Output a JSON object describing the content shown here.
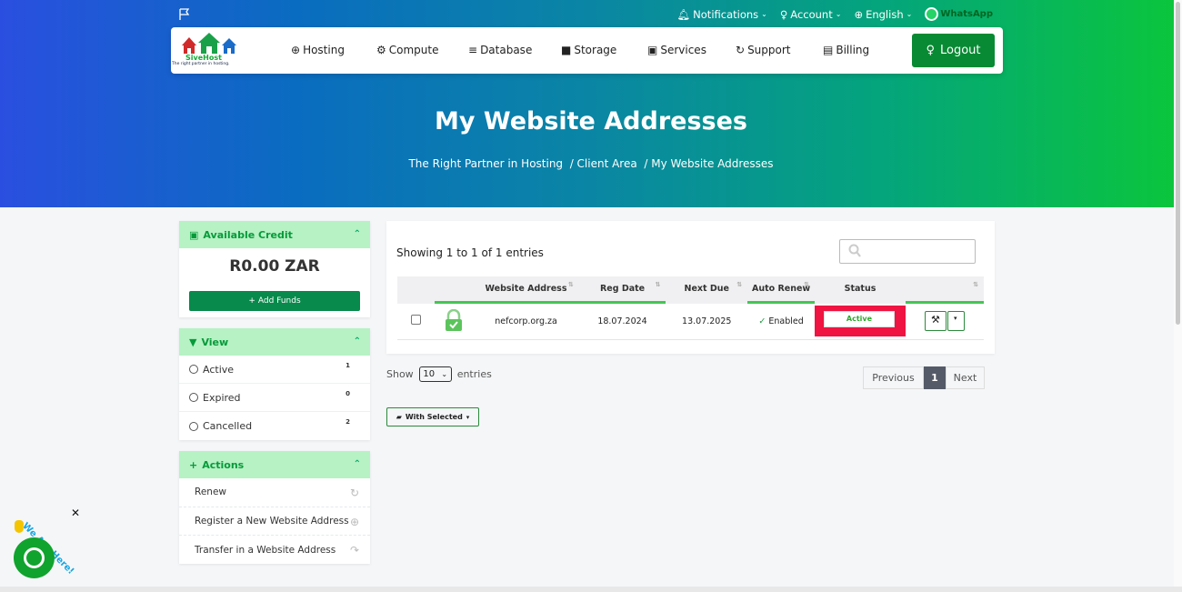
{
  "topbar": {
    "notifications": "Notifications",
    "account": "Account",
    "language": "English",
    "whatsapp": "WhatsApp"
  },
  "brand": {
    "name": "SiveHost",
    "tagline": "The right partner in hosting."
  },
  "nav": {
    "items": [
      "Hosting",
      "Compute",
      "Database",
      "Storage",
      "Services",
      "Support",
      "Billing"
    ],
    "logout": "Logout"
  },
  "hero": {
    "title": "My Website Addresses",
    "breadcrumb": [
      "The Right Partner in Hosting",
      "Client Area",
      "My Website Addresses"
    ]
  },
  "sidebar": {
    "credit": {
      "title": "Available Credit",
      "amount": "R0.00 ZAR",
      "add_funds": "Add Funds"
    },
    "view": {
      "title": "View",
      "items": [
        {
          "label": "Active",
          "count": "1"
        },
        {
          "label": "Expired",
          "count": "0"
        },
        {
          "label": "Cancelled",
          "count": "2"
        }
      ]
    },
    "actions": {
      "title": "Actions",
      "items": [
        {
          "label": "Renew",
          "icon": "refresh-icon"
        },
        {
          "label": "Register a New Website Address",
          "icon": "globe-icon"
        },
        {
          "label": "Transfer in a Website Address",
          "icon": "share-icon"
        }
      ]
    }
  },
  "table": {
    "showing": "Showing 1 to 1 of 1 entries",
    "search_placeholder": "",
    "columns": [
      "",
      "",
      "Website Address",
      "Reg Date",
      "Next Due",
      "Auto Renew",
      "Status",
      ""
    ],
    "rows": [
      {
        "domain": "nefcorp.org.za",
        "reg_date": "18.07.2024",
        "next_due": "13.07.2025",
        "auto_renew": "Enabled",
        "status": "Active"
      }
    ],
    "show_label": "Show",
    "page_length": "10",
    "entries_label": "entries",
    "pager": {
      "previous": "Previous",
      "current": "1",
      "next": "Next"
    },
    "with_selected": "With Selected"
  },
  "chat": {
    "text": "We Are Here!"
  },
  "colors": {
    "accent": "#078a33",
    "header_light": "#b6f2c4",
    "status_highlight": "#ef1441"
  }
}
